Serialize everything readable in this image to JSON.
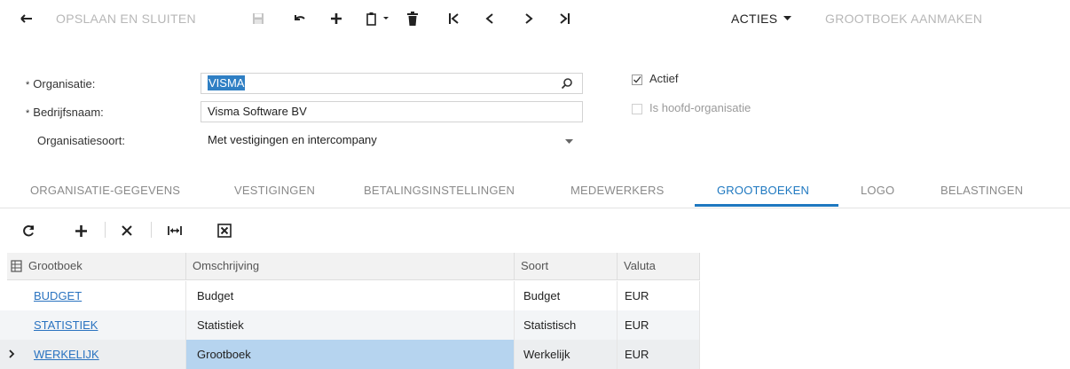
{
  "toolbar": {
    "save_close": "OPSLAAN EN SLUITEN",
    "actions": "ACTIES",
    "create_ledger": "GROOTBOEK AANMAKEN"
  },
  "form": {
    "organisation_label": "Organisatie:",
    "organisation_value": "VISMA",
    "company_label": "Bedrijfsnaam:",
    "company_value": "Visma Software BV",
    "orgtype_label": "Organisatiesoort:",
    "orgtype_value": "Met vestigingen en intercompany",
    "required_mark": "*",
    "active_label": "Actief",
    "active_checked": true,
    "head_org_label": "Is hoofd-organisatie",
    "head_org_checked": false
  },
  "tabs": [
    {
      "label": "ORGANISATIE-GEGEVENS"
    },
    {
      "label": "VESTIGINGEN"
    },
    {
      "label": "BETALINGSINSTELLINGEN"
    },
    {
      "label": "MEDEWERKERS"
    },
    {
      "label": "GROOTBOEKEN",
      "active": true
    },
    {
      "label": "LOGO"
    },
    {
      "label": "BELASTINGEN"
    }
  ],
  "grid": {
    "columns": [
      "Grootboek",
      "Omschrijving",
      "Soort",
      "Valuta"
    ],
    "rows": [
      {
        "ledger": "BUDGET",
        "description": "Budget",
        "type": "Budget",
        "currency": "EUR"
      },
      {
        "ledger": "STATISTIEK",
        "description": "Statistiek",
        "type": "Statistisch",
        "currency": "EUR"
      },
      {
        "ledger": "WERKELIJK",
        "description": "Grootboek",
        "type": "Werkelijk",
        "currency": "EUR"
      }
    ]
  },
  "colors": {
    "accent": "#1e78c0",
    "link": "#2a73c0",
    "selection": "#b6d4ef"
  }
}
